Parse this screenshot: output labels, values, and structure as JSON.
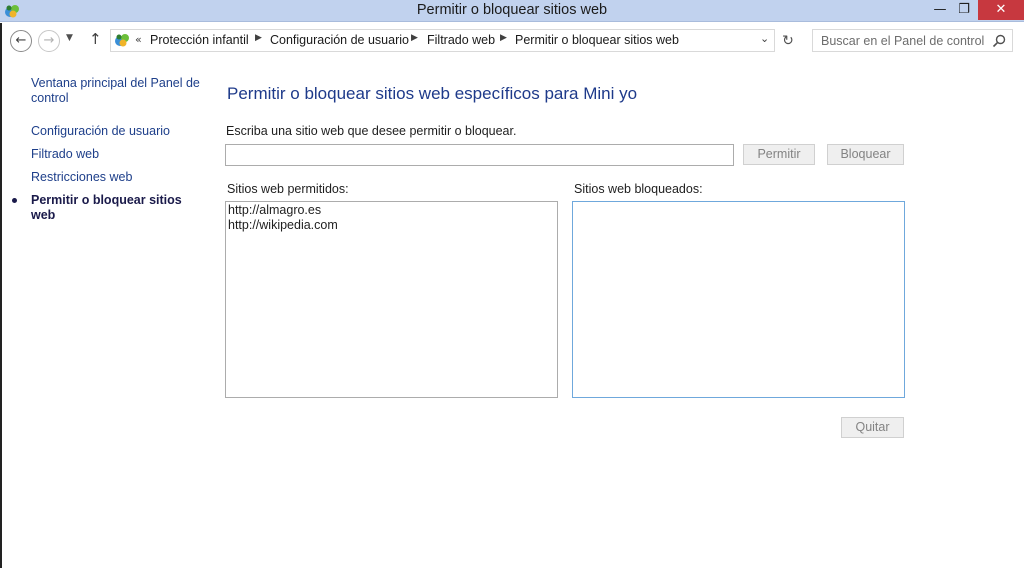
{
  "window": {
    "title": "Permitir o bloquear sitios web",
    "minimize_glyph": "—",
    "maximize_glyph": "❐",
    "close_glyph": "✕",
    "icon": "control-panel-icon"
  },
  "navigation": {
    "back_glyph": "←",
    "forward_glyph": "→",
    "recent_glyph": "▼",
    "up_glyph": "↑",
    "refresh_glyph": "↻",
    "address_chevron": "«",
    "breadcrumb_separator": "▶",
    "address_dropdown_glyph": "⌄",
    "breadcrumbs": [
      "Protección infantil",
      "Configuración de usuario",
      "Filtrado web",
      "Permitir o bloquear sitios web"
    ],
    "search_placeholder": "Buscar en el Panel de control"
  },
  "sidebar": {
    "items": [
      "Ventana principal del Panel de control",
      "Configuración de usuario",
      "Filtrado web",
      "Restricciones web",
      "Permitir o bloquear sitios web"
    ],
    "current_index": 4
  },
  "main": {
    "title": "Permitir o bloquear sitios web específicos para Mini yo",
    "instruction": "Escriba una sitio web que desee permitir o bloquear.",
    "input_value": "",
    "allow_button": "Permitir",
    "block_button": "Bloquear",
    "allowed_label": "Sitios web permitidos:",
    "blocked_label": "Sitios web bloqueados:",
    "allowed_sites": [
      "http://almagro.es",
      "http://wikipedia.com"
    ],
    "blocked_sites": [],
    "remove_button": "Quitar"
  },
  "colors": {
    "titlebar": "#c1d2ee",
    "close_button": "#c7383f",
    "link": "#1e3f8a",
    "heading": "#1e3a8a",
    "focused_border": "#6fa8dc"
  }
}
